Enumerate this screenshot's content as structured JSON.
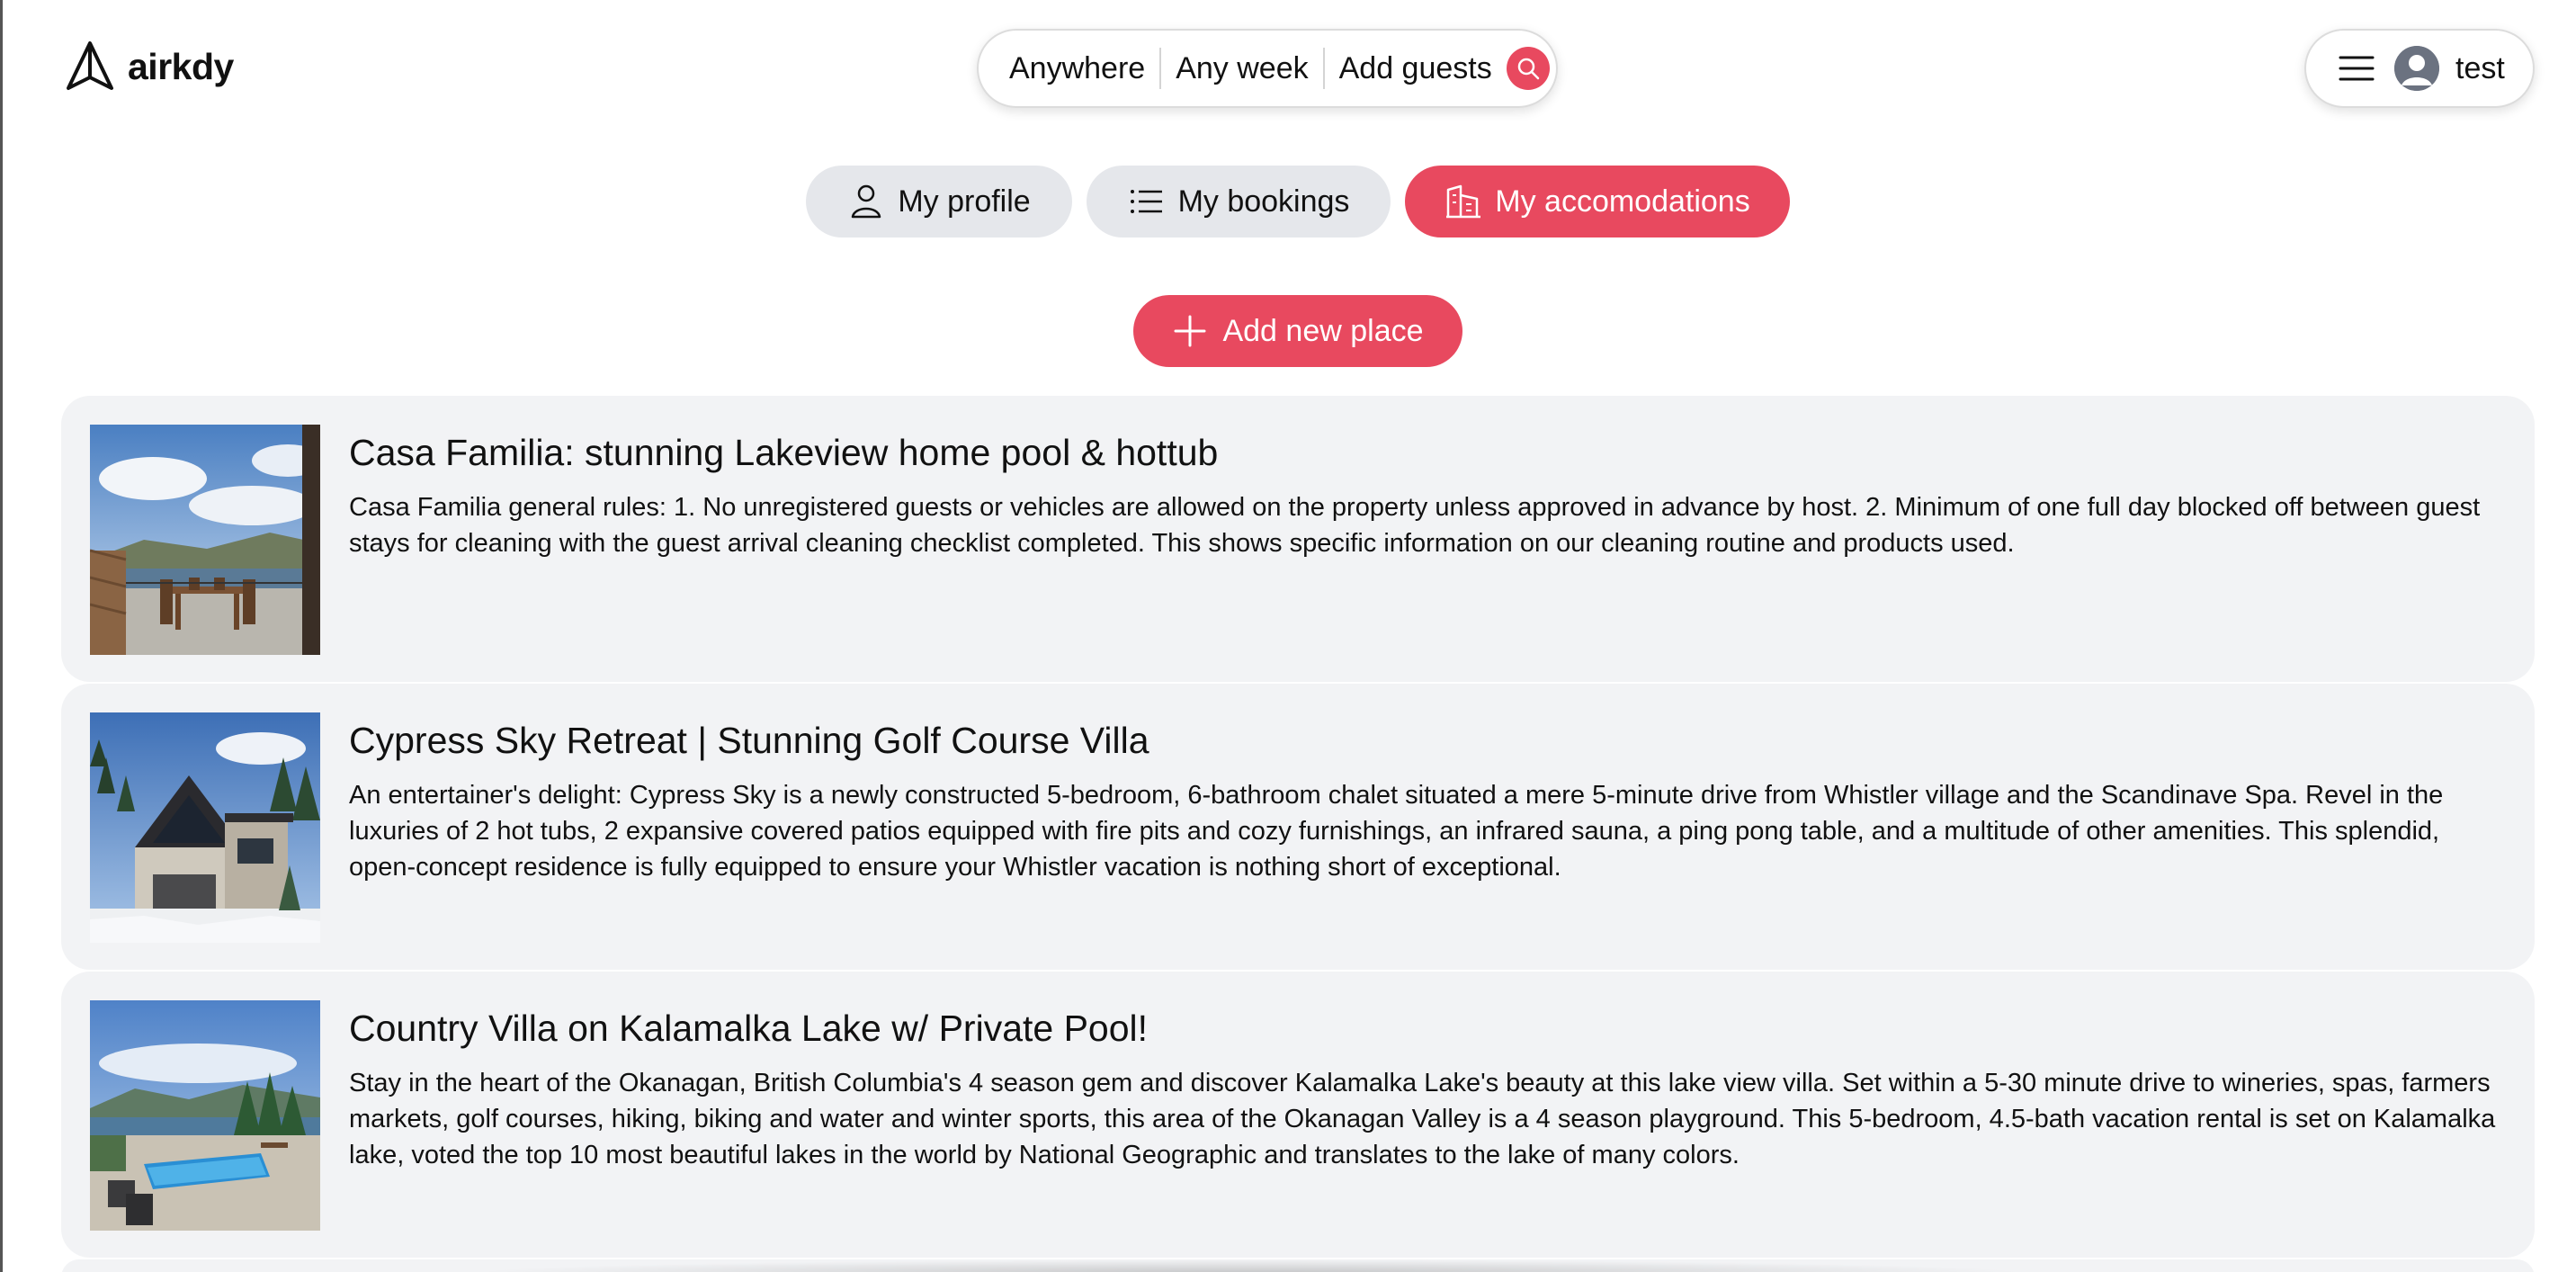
{
  "brand": {
    "name": "airkdy"
  },
  "search": {
    "where": "Anywhere",
    "when": "Any week",
    "guests": "Add guests"
  },
  "user": {
    "name": "test"
  },
  "tabs": [
    {
      "label": "My profile",
      "icon": "person-icon"
    },
    {
      "label": "My bookings",
      "icon": "list-icon"
    },
    {
      "label": "My accomodations",
      "icon": "building-icon",
      "active": true
    }
  ],
  "add_place": {
    "label": "Add new place"
  },
  "colors": {
    "accent": "#e8495f",
    "tab_bg": "#e5e7eb",
    "card_bg": "#f2f3f5"
  },
  "listings": [
    {
      "title": "Casa Familia: stunning Lakeview home pool & hottub",
      "description": "Casa Familia general rules: 1. No unregistered guests or vehicles are allowed on the property unless approved in advance by host. 2. Minimum of one full day blocked off between guest stays for cleaning with the guest arrival cleaning checklist completed. This shows specific information on our cleaning routine and products used."
    },
    {
      "title": "Cypress Sky Retreat | Stunning Golf Course Villa",
      "description": "An entertainer's delight: Cypress Sky is a newly constructed 5-bedroom, 6-bathroom chalet situated a mere 5-minute drive from Whistler village and the Scandinave Spa. Revel in the luxuries of 2 hot tubs, 2 expansive covered patios equipped with fire pits and cozy furnishings, an infrared sauna, a ping pong table, and a multitude of other amenities. This splendid, open-concept residence is fully equipped to ensure your Whistler vacation is nothing short of exceptional."
    },
    {
      "title": "Country Villa on Kalamalka Lake w/ Private Pool!",
      "description": "Stay in the heart of the Okanagan, British Columbia's 4 season gem and discover Kalamalka Lake's beauty at this lake view villa. Set within a 5-30 minute drive to wineries, spas, farmers markets, golf courses, hiking, biking and water and winter sports, this area of the Okanagan Valley is a 4 season playground. This 5-bedroom, 4.5-bath vacation rental is set on Kalamalka lake, voted the top 10 most beautiful lakes in the world by National Geographic and translates to the lake of many colors."
    }
  ]
}
